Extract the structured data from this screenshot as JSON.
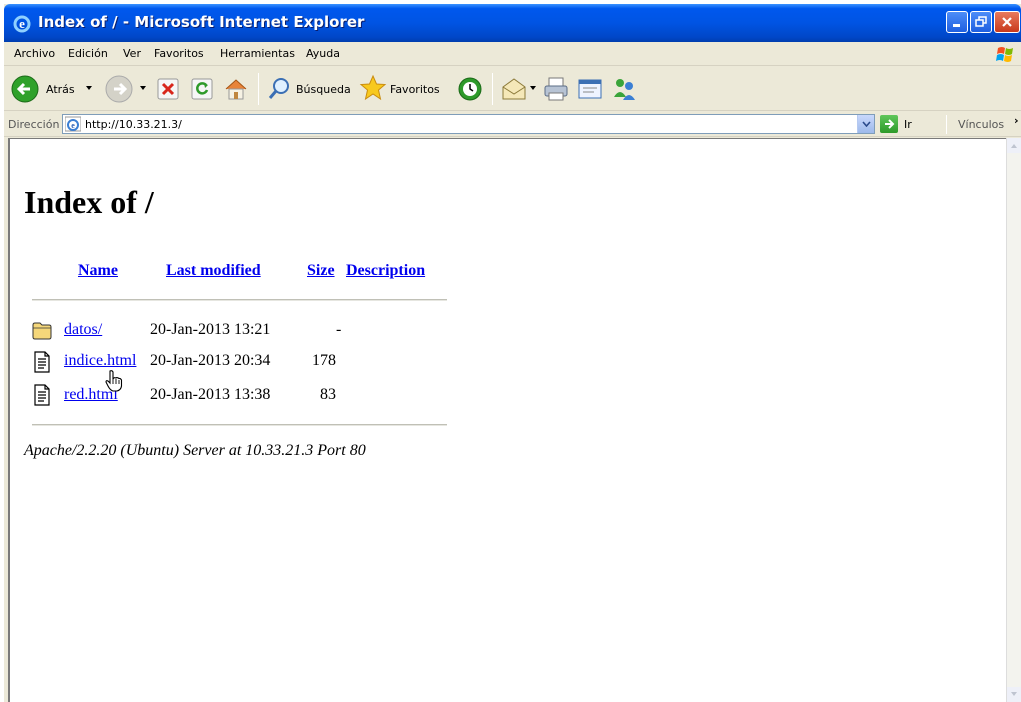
{
  "window": {
    "title": "Index of / - Microsoft Internet Explorer"
  },
  "menu": [
    "Archivo",
    "Edición",
    "Ver",
    "Favoritos",
    "Herramientas",
    "Ayuda"
  ],
  "toolbar": {
    "back_label": "Atrás",
    "search_label": "Búsqueda",
    "favorites_label": "Favoritos"
  },
  "address": {
    "label": "Dirección",
    "url": "http://10.33.21.3/",
    "go_label": "Ir",
    "links_label": "Vínculos"
  },
  "page": {
    "heading": "Index of /",
    "columns": {
      "name": "Name",
      "last_modified": "Last modified",
      "size": "Size",
      "description": "Description"
    },
    "rows": [
      {
        "name": "datos/",
        "modified": "20-Jan-2013 13:21",
        "size": "-",
        "icon": "folder-icon"
      },
      {
        "name": "indice.html",
        "modified": "20-Jan-2013 20:34",
        "size": "178",
        "icon": "file-icon"
      },
      {
        "name": "red.html",
        "modified": "20-Jan-2013 13:38",
        "size": "83",
        "icon": "file-icon"
      }
    ],
    "footer": "Apache/2.2.20 (Ubuntu) Server at 10.33.21.3 Port 80"
  },
  "colors": {
    "titlebar": "#0054e3",
    "link": "#0000ee",
    "chrome": "#ece9d8"
  }
}
